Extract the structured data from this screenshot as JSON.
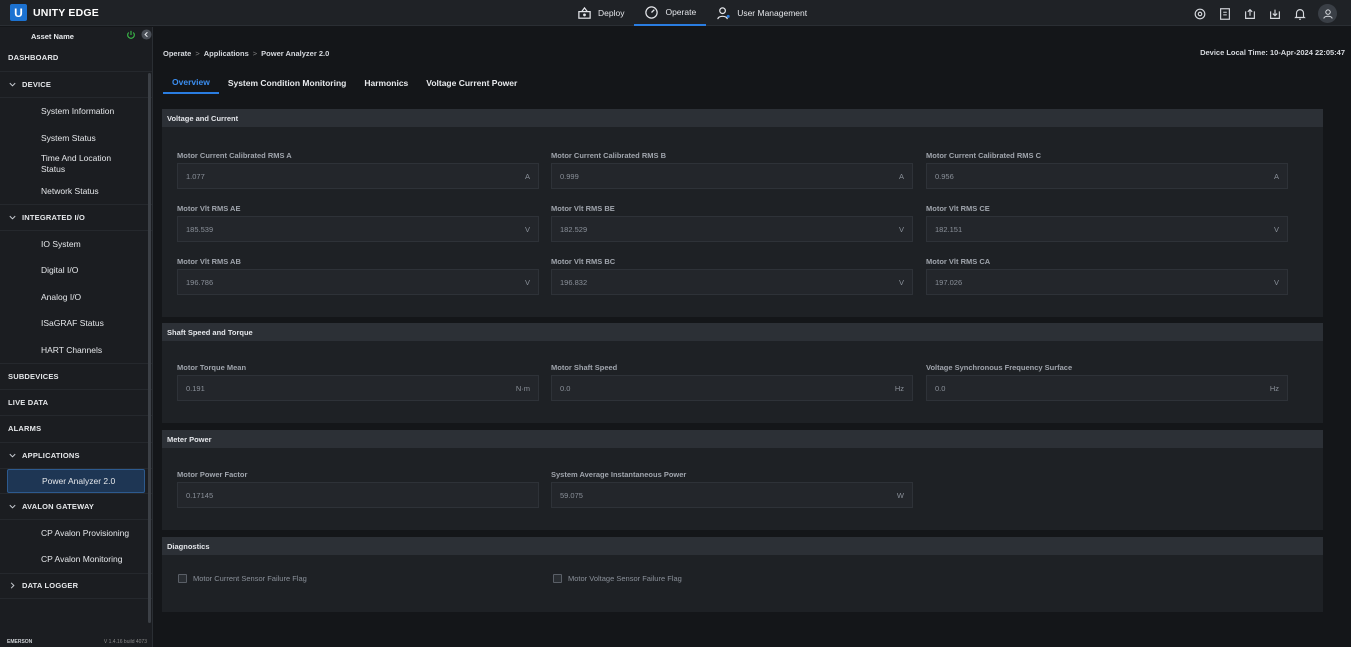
{
  "brand": {
    "logo_letter": "U",
    "name": "UNITY EDGE"
  },
  "topnav": [
    {
      "label": "Deploy",
      "icon": "deploy-icon"
    },
    {
      "label": "Operate",
      "icon": "gauge-icon",
      "active": true
    },
    {
      "label": "User Management",
      "icon": "user-gear-icon"
    }
  ],
  "sidebar": {
    "header": "Asset Name",
    "items": [
      {
        "label": "DASHBOARD",
        "type": "section"
      },
      {
        "label": "DEVICE",
        "type": "section",
        "expanded": true
      },
      {
        "label": "System Information",
        "type": "sub"
      },
      {
        "label": "System Status",
        "type": "sub"
      },
      {
        "label": "Time And Location Status",
        "type": "sub"
      },
      {
        "label": "Network Status",
        "type": "sub"
      },
      {
        "label": "INTEGRATED I/O",
        "type": "section",
        "expanded": true
      },
      {
        "label": "IO System",
        "type": "sub"
      },
      {
        "label": "Digital I/O",
        "type": "sub"
      },
      {
        "label": "Analog I/O",
        "type": "sub"
      },
      {
        "label": "ISaGRAF Status",
        "type": "sub"
      },
      {
        "label": "HART Channels",
        "type": "sub"
      },
      {
        "label": "SUBDEVICES",
        "type": "section"
      },
      {
        "label": "LIVE DATA",
        "type": "section"
      },
      {
        "label": "ALARMS",
        "type": "section"
      },
      {
        "label": "APPLICATIONS",
        "type": "section",
        "expanded": true
      },
      {
        "label": "Power Analyzer 2.0",
        "type": "sub",
        "active": true
      },
      {
        "label": "AVALON GATEWAY",
        "type": "section",
        "expanded": true
      },
      {
        "label": "CP Avalon Provisioning",
        "type": "sub"
      },
      {
        "label": "CP Avalon Monitoring",
        "type": "sub"
      },
      {
        "label": "DATA LOGGER",
        "type": "section",
        "expanded": false
      }
    ],
    "footer_left": "EMERSON",
    "footer_right": "V 1.4.16 build 4073"
  },
  "breadcrumb": [
    "Operate",
    "Applications",
    "Power Analyzer 2.0"
  ],
  "device_time": "Device Local Time: 10-Apr-2024 22:05:47",
  "tabs": [
    {
      "label": "Overview",
      "active": true
    },
    {
      "label": "System Condition Monitoring"
    },
    {
      "label": "Harmonics"
    },
    {
      "label": "Voltage Current Power"
    }
  ],
  "sections": {
    "voltage_current": {
      "title": "Voltage and Current",
      "fields": [
        {
          "label": "Motor Current Calibrated RMS A",
          "value": "1.077",
          "unit": "A"
        },
        {
          "label": "Motor Current Calibrated RMS B",
          "value": "0.999",
          "unit": "A"
        },
        {
          "label": "Motor Current Calibrated RMS C",
          "value": "0.956",
          "unit": "A"
        },
        {
          "label": "Motor Vlt RMS AE",
          "value": "185.539",
          "unit": "V"
        },
        {
          "label": "Motor Vlt RMS BE",
          "value": "182.529",
          "unit": "V"
        },
        {
          "label": "Motor Vlt RMS CE",
          "value": "182.151",
          "unit": "V"
        },
        {
          "label": "Motor Vlt RMS AB",
          "value": "196.786",
          "unit": "V"
        },
        {
          "label": "Motor Vlt RMS BC",
          "value": "196.832",
          "unit": "V"
        },
        {
          "label": "Motor Vlt RMS CA",
          "value": "197.026",
          "unit": "V"
        }
      ]
    },
    "shaft": {
      "title": "Shaft Speed and Torque",
      "fields": [
        {
          "label": "Motor Torque Mean",
          "value": "0.191",
          "unit": "N·m"
        },
        {
          "label": "Motor Shaft Speed",
          "value": "0.0",
          "unit": "Hz"
        },
        {
          "label": "Voltage Synchronous Frequency Surface",
          "value": "0.0",
          "unit": "Hz"
        }
      ]
    },
    "meter": {
      "title": "Meter Power",
      "fields": [
        {
          "label": "Motor Power Factor",
          "value": "0.17145",
          "unit": ""
        },
        {
          "label": "System Average Instantaneous Power",
          "value": "59.075",
          "unit": "W"
        }
      ]
    },
    "diagnostics": {
      "title": "Diagnostics",
      "checks": [
        {
          "label": "Motor Current Sensor Failure Flag",
          "checked": false
        },
        {
          "label": "Motor Voltage Sensor Failure Flag",
          "checked": false
        }
      ]
    }
  },
  "colors": {
    "accent": "#2a7de1",
    "background": "#141619",
    "panel": "#1e2125"
  }
}
